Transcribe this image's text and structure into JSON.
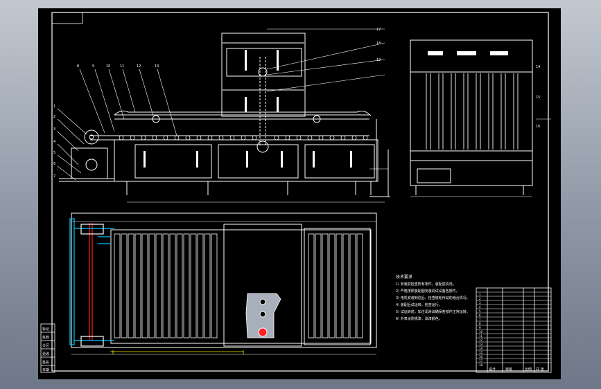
{
  "drawing": {
    "balloon_numbers_front": [
      "8",
      "9",
      "10",
      "11",
      "12",
      "13"
    ],
    "balloon_numbers_right": [
      "14",
      "15",
      "16",
      "17",
      "18",
      "19"
    ],
    "balloon_numbers_left": [
      "1",
      "2",
      "3",
      "4",
      "5",
      "6",
      "7"
    ],
    "notes_title": "技术要求",
    "notes_lines": [
      "1) 安装前检查所有零件，装配前清洗。",
      "2) 严格按照装配图安装调试设备各部件。",
      "3) 电机安装到位后，检查链轮传动的啮合情况。",
      "4) 装配后试运转，检查运行。",
      "5) 试运转前，加注润滑油确保各部件正常运转。",
      "6) 外表涂防锈漆，油漆颜色。"
    ],
    "title_block_rows": [
      "1",
      "2",
      "3",
      "4",
      "5",
      "6",
      "7",
      "8",
      "9",
      "10",
      "11",
      "12",
      "13",
      "14",
      "15",
      "16",
      "17",
      "18"
    ],
    "side_table_labels": [
      "标记",
      "处数",
      "分区",
      "更改",
      "签名",
      "日期"
    ],
    "title_block_bottom": [
      "设计",
      "审核",
      "比例",
      "共 张"
    ]
  },
  "colors": {
    "background": "#000000",
    "lines": "#ffffff",
    "cyan": "#00c8ff",
    "red": "#ff2020",
    "yellow": "#ffe000",
    "chassis": "#a8b0bc"
  }
}
